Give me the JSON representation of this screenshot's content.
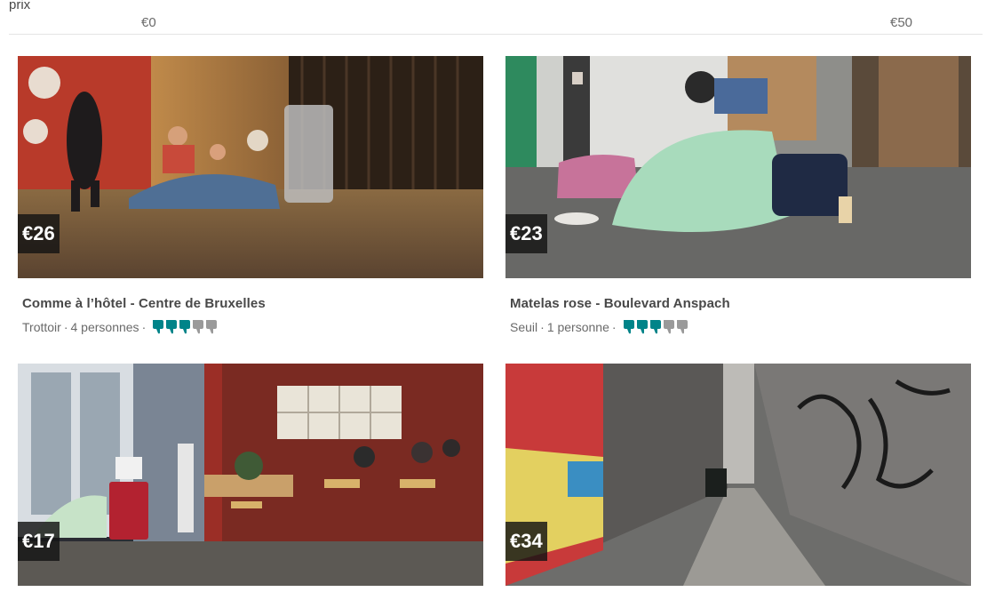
{
  "price_filter": {
    "label": "prix",
    "min": "€0",
    "max": "€50"
  },
  "colors": {
    "rating_on": "#008489",
    "rating_off": "#9a9a9a"
  },
  "listings": [
    {
      "price": "€26",
      "title": "Comme à l’hôtel - Centre de Bruxelles",
      "type": "Trottoir",
      "guests": "4 personnes",
      "rating": 3,
      "rating_max": 5,
      "photo": "homeless-people-sitting-under-blankets-on-sidewalk-at-night"
    },
    {
      "price": "€23",
      "title": "Matelas rose - Boulevard Anspach",
      "type": "Seuil",
      "guests": "1 personne",
      "rating": 3,
      "rating_max": 5,
      "photo": "person-wrapped-in-green-blanket-in-doorway"
    },
    {
      "price": "€17",
      "photo": "person-lying-under-blanket-next-to-cafe-terrace"
    },
    {
      "price": "€34",
      "photo": "graffiti-covered-narrow-alley"
    }
  ]
}
